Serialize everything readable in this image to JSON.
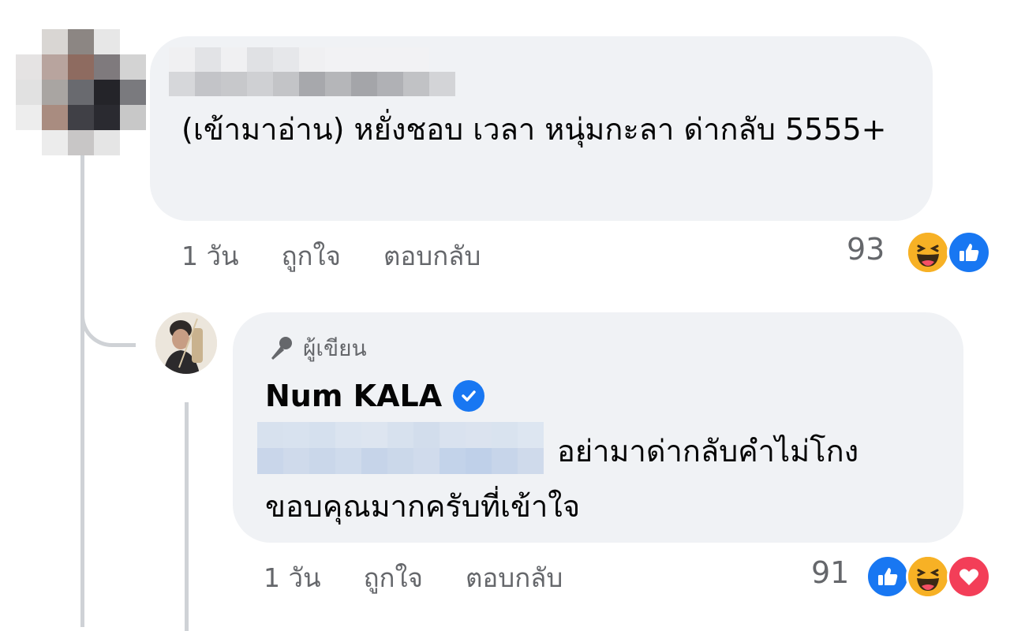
{
  "thread": {
    "comment": {
      "text": "(เข้ามาอ่าน) หยั่งชอบ เวลา หนุ่มกะลา ด่ากลับ 5555+",
      "time": "1 วัน",
      "like_label": "ถูกใจ",
      "reply_label": "ตอบกลับ",
      "reaction_count": "93",
      "reactions": [
        "haha",
        "like"
      ]
    },
    "reply": {
      "author_badge": "ผู้เขียน",
      "author_name": "Num KALA",
      "verified": true,
      "text_line1": "อย่ามาด่ากลับคำไม่โกง",
      "text_line2": "ขอบคุณมากครับที่เข้าใจ",
      "time": "1 วัน",
      "like_label": "ถูกใจ",
      "reply_label": "ตอบกลับ",
      "reaction_count": "91",
      "reactions": [
        "like",
        "haha",
        "love"
      ]
    }
  },
  "colors": {
    "bubble_bg": "#f0f2f5",
    "meta_text": "#65676b",
    "like_blue": "#1877f2",
    "haha_yellow": "#f7b125",
    "love_red": "#f33e58",
    "thread_line": "#cfd2d6"
  },
  "icons": {
    "author_badge_icon": "microphone-icon",
    "verified_icon": "verified-badge-icon"
  }
}
